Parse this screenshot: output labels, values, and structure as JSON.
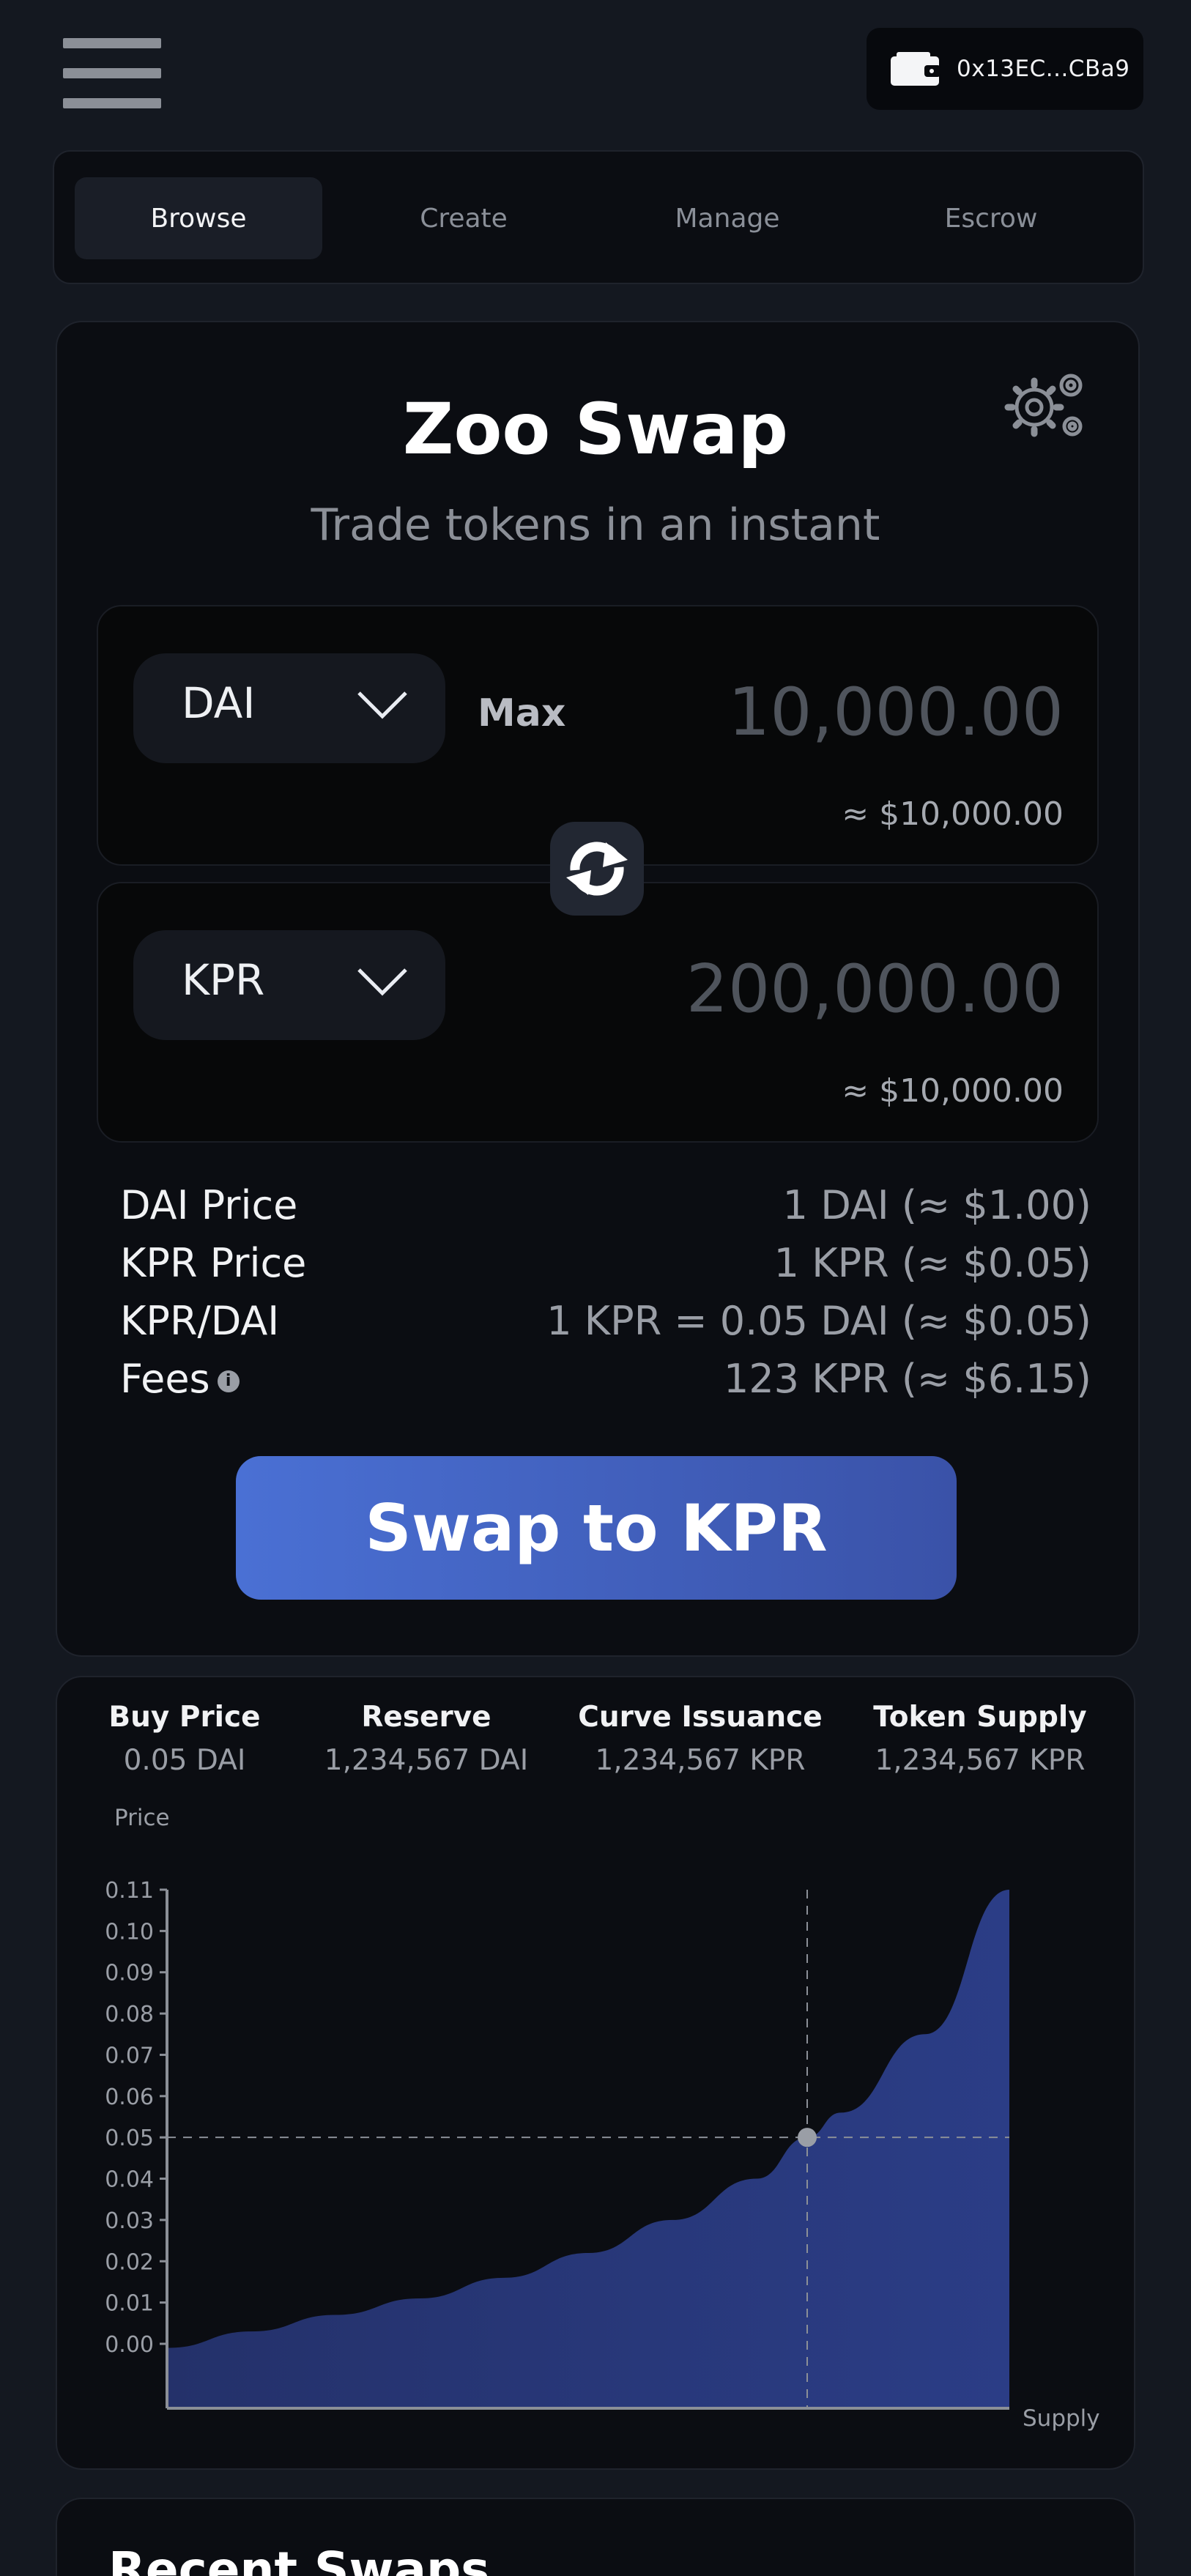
{
  "header": {
    "wallet_address": "0x13EC...CBa9",
    "menu_icon": "hamburger-menu-icon",
    "wallet_icon": "wallet-icon"
  },
  "tabs": [
    {
      "label": "Browse",
      "active": true
    },
    {
      "label": "Create",
      "active": false
    },
    {
      "label": "Manage",
      "active": false
    },
    {
      "label": "Escrow",
      "active": false
    }
  ],
  "swap": {
    "title": "Zoo Swap",
    "subtitle": "Trade tokens in an instant",
    "settings_icon": "gear-icon",
    "from": {
      "token": "DAI",
      "max_label": "Max",
      "amount": "10,000.00",
      "usd": "≈ $10,000.00"
    },
    "to": {
      "token": "KPR",
      "amount": "200,000.00",
      "usd": "≈ $10,000.00"
    },
    "toggle_icon": "swap-arrows-icon",
    "info": [
      {
        "label": "DAI Price",
        "value": "1 DAI  (≈ $1.00)"
      },
      {
        "label": "KPR Price",
        "value": "1 KPR  (≈ $0.05)"
      },
      {
        "label": "KPR/DAI",
        "value": "1 KPR = 0.05 DAI (≈ $0.05)"
      },
      {
        "label": "Fees",
        "value": "123 KPR  (≈ $6.15)"
      }
    ],
    "swap_button": "Swap to KPR"
  },
  "stats": [
    {
      "label": "Buy Price",
      "value": "0.05 DAI"
    },
    {
      "label": "Reserve",
      "value": "1,234,567 DAI"
    },
    {
      "label": "Curve Issuance",
      "value": "1,234,567 KPR"
    },
    {
      "label": "Token Supply",
      "value": "1,234,567 KPR"
    }
  ],
  "chart_data": {
    "type": "area",
    "title": "",
    "ylabel": "Price",
    "xlabel": "Supply",
    "ylim": [
      0.0,
      0.11
    ],
    "y_ticks": [
      "0.00",
      "0.01",
      "0.02",
      "0.03",
      "0.04",
      "0.05",
      "0.06",
      "0.07",
      "0.08",
      "0.09",
      "0.10",
      "0.11"
    ],
    "x": [
      0.0,
      0.1,
      0.2,
      0.3,
      0.4,
      0.5,
      0.6,
      0.7,
      0.76,
      0.8,
      0.9,
      1.0
    ],
    "values": [
      -0.001,
      0.003,
      0.007,
      0.011,
      0.016,
      0.022,
      0.03,
      0.04,
      0.05,
      0.056,
      0.075,
      0.11
    ],
    "marker": {
      "x": 0.76,
      "y": 0.05
    },
    "colors": {
      "fill": "#2b3d86",
      "axis": "#8b8f97",
      "marker": "#9a9ea6"
    },
    "grid": false
  },
  "recent": {
    "title": "Recent Swaps"
  }
}
